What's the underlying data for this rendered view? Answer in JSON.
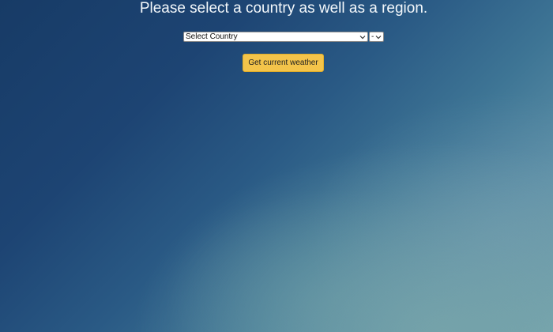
{
  "header": {
    "title": "Please select a country as well as a region."
  },
  "form": {
    "country_select": {
      "selected": "Select Country",
      "icon": "chevron-down-icon"
    },
    "region_select": {
      "selected": "-",
      "icon": "chevron-down-icon"
    },
    "submit_label": "Get current weather"
  },
  "colors": {
    "button_background": "#f4c44a",
    "background_dark": "#173b66",
    "background_light": "#75a6ad",
    "title_text": "#f4f8fb"
  }
}
